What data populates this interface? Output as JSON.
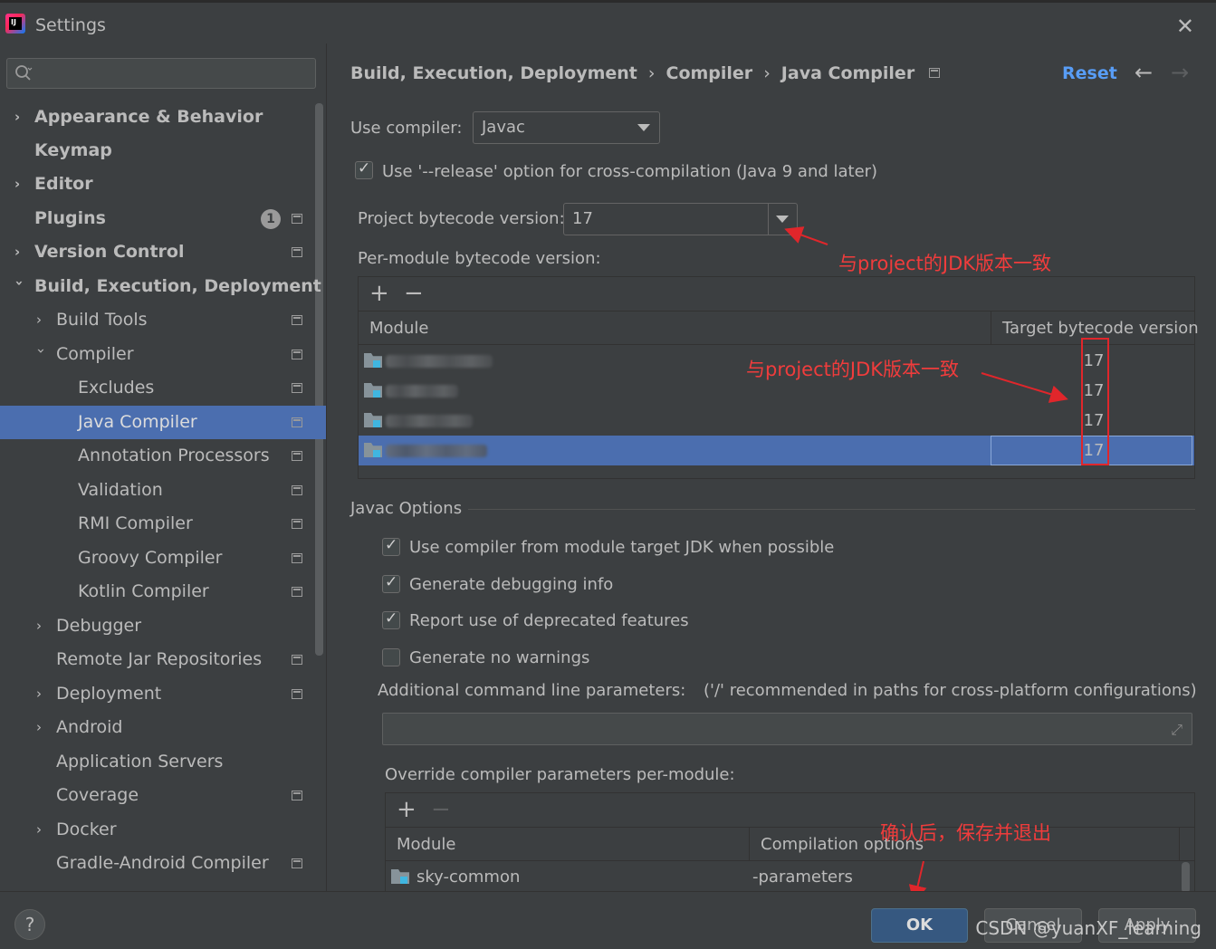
{
  "window": {
    "title": "Settings",
    "app_icon_text": "IJ"
  },
  "sidebar": {
    "search_placeholder": "",
    "notification_count": "1",
    "items": [
      {
        "label": "Appearance & Behavior"
      },
      {
        "label": "Keymap"
      },
      {
        "label": "Editor"
      },
      {
        "label": "Plugins"
      },
      {
        "label": "Version Control"
      },
      {
        "label": "Build, Execution, Deployment"
      },
      {
        "label": "Build Tools"
      },
      {
        "label": "Compiler"
      },
      {
        "label": "Excludes"
      },
      {
        "label": "Java Compiler"
      },
      {
        "label": "Annotation Processors"
      },
      {
        "label": "Validation"
      },
      {
        "label": "RMI Compiler"
      },
      {
        "label": "Groovy Compiler"
      },
      {
        "label": "Kotlin Compiler"
      },
      {
        "label": "Debugger"
      },
      {
        "label": "Remote Jar Repositories"
      },
      {
        "label": "Deployment"
      },
      {
        "label": "Android"
      },
      {
        "label": "Application Servers"
      },
      {
        "label": "Coverage"
      },
      {
        "label": "Docker"
      },
      {
        "label": "Gradle-Android Compiler"
      }
    ]
  },
  "header": {
    "breadcrumb": [
      "Build, Execution, Deployment",
      "Compiler",
      "Java Compiler"
    ],
    "reset_label": "Reset"
  },
  "form": {
    "use_compiler_label": "Use compiler:",
    "use_compiler_value": "Javac",
    "release_option_label": "Use '--release' option for cross-compilation (Java 9 and later)",
    "bytecode_label": "Project bytecode version:",
    "bytecode_value": "17",
    "per_module_label": "Per-module bytecode version:",
    "module_table": {
      "columns": [
        "Module",
        "Target bytecode version"
      ],
      "rows": [
        {
          "module": "",
          "version": "17"
        },
        {
          "module": "",
          "version": "17"
        },
        {
          "module": "",
          "version": "17"
        },
        {
          "module": "",
          "version": "17"
        }
      ]
    },
    "javac_options_title": "Javac Options",
    "options": [
      {
        "label": "Use compiler from module target JDK when possible",
        "checked": true
      },
      {
        "label": "Generate debugging info",
        "checked": true
      },
      {
        "label": "Report use of deprecated features",
        "checked": true
      },
      {
        "label": "Generate no warnings",
        "checked": false
      }
    ],
    "additional_params_label": "Additional command line parameters:",
    "additional_params_hint": "('/' recommended in paths for cross-platform configurations)",
    "additional_params_value": "",
    "override_label": "Override compiler parameters per-module:",
    "override_table": {
      "columns": [
        "Module",
        "Compilation options"
      ],
      "rows": [
        {
          "module": "sky-common",
          "options": "-parameters"
        }
      ]
    }
  },
  "annotations": {
    "note1": "与project的JDK版本一致",
    "note2": "与project的JDK版本一致",
    "note3": "确认后，保存并退出",
    "color": "#f03c3c"
  },
  "footer": {
    "help_label": "?",
    "ok_label": "OK",
    "cancel_label": "Cancel",
    "apply_label": "Apply",
    "watermark": "CSDN @yuanXF_learning"
  },
  "colors": {
    "background": "#3c3f41",
    "selection": "#4b6eaf",
    "link": "#589df6",
    "primary_button": "#365880"
  }
}
